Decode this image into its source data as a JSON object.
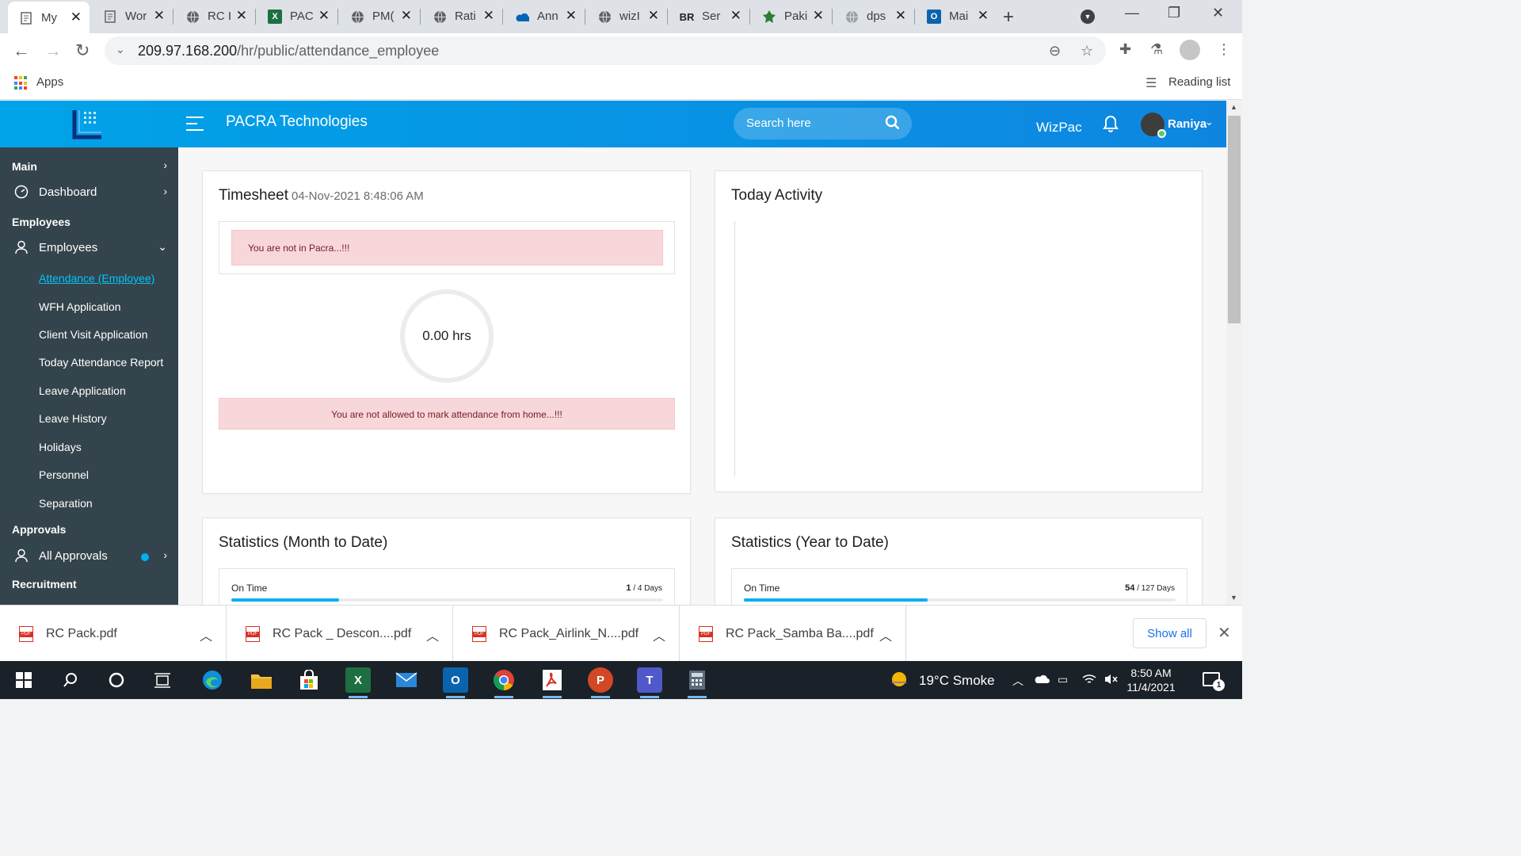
{
  "browser": {
    "tabs": [
      {
        "title": "My",
        "icon": "doc-icon",
        "active": true
      },
      {
        "title": "Wor",
        "icon": "doc-icon"
      },
      {
        "title": "RC I",
        "icon": "globe-icon"
      },
      {
        "title": "PAC",
        "icon": "excel-icon"
      },
      {
        "title": "PM(",
        "icon": "globe-icon"
      },
      {
        "title": "Rati",
        "icon": "globe-icon"
      },
      {
        "title": "Ann",
        "icon": "cloud-icon"
      },
      {
        "title": "wizI",
        "icon": "globe-icon"
      },
      {
        "title": "Ser",
        "icon": "br-icon",
        "icon_text": "BR"
      },
      {
        "title": "Paki",
        "icon": "emblem-icon"
      },
      {
        "title": "dps",
        "icon": "globe-icon"
      },
      {
        "title": "Mai",
        "icon": "outlook-icon"
      }
    ],
    "url_host": "209.97.168.200",
    "url_path": "/hr/public/attendance_employee",
    "bookmarks": {
      "apps_label": "Apps",
      "reading_list_label": "Reading list"
    }
  },
  "app": {
    "brand": "PACRA Technologies",
    "search_placeholder": "Search here",
    "wizpac_label": "WizPac",
    "user_name": "Raniya",
    "colors": {
      "header_start": "#00a3e8",
      "header_end": "#0e86e0",
      "sidebar": "#34444c",
      "active_link": "#00c5fb",
      "alert_bg": "#f8d7da",
      "progress": "#00aff0"
    }
  },
  "sidebar": {
    "main_section": "Main",
    "dashboard": "Dashboard",
    "employees_section": "Employees",
    "employees_menu": "Employees",
    "sub_items": [
      "Attendance (Employee)",
      "WFH Application",
      "Client Visit Application",
      "Today Attendance Report",
      "Leave Application",
      "Leave History",
      "Holidays",
      "Personnel",
      "Separation"
    ],
    "approvals_section": "Approvals",
    "all_approvals": "All Approvals",
    "recruitment_section": "Recruitment"
  },
  "timesheet": {
    "title": "Timesheet",
    "timestamp": "04-Nov-2021 8:48:06 AM",
    "alert_location": "You are not in Pacra...!!!",
    "hours": "0.00 hrs",
    "alert_wfh": "You are not allowed to mark attendance from home...!!!"
  },
  "activity": {
    "title": "Today Activity"
  },
  "stats_month": {
    "title": "Statistics (Month to Date)",
    "label": "On Time",
    "value": "1",
    "total": "/ 4 Days",
    "fraction": 0.25
  },
  "stats_year": {
    "title": "Statistics (Year to Date)",
    "label": "On Time",
    "value": "54",
    "total": "/ 127 Days",
    "fraction": 0.425
  },
  "downloads": {
    "files": [
      "RC Pack.pdf",
      "RC Pack _ Descon....pdf",
      "RC Pack_Airlink_N....pdf",
      "RC Pack_Samba Ba....pdf"
    ],
    "show_all": "Show all"
  },
  "taskbar": {
    "weather": "19°C  Smoke",
    "time": "8:50 AM",
    "date": "11/4/2021",
    "notification_count": "1"
  }
}
